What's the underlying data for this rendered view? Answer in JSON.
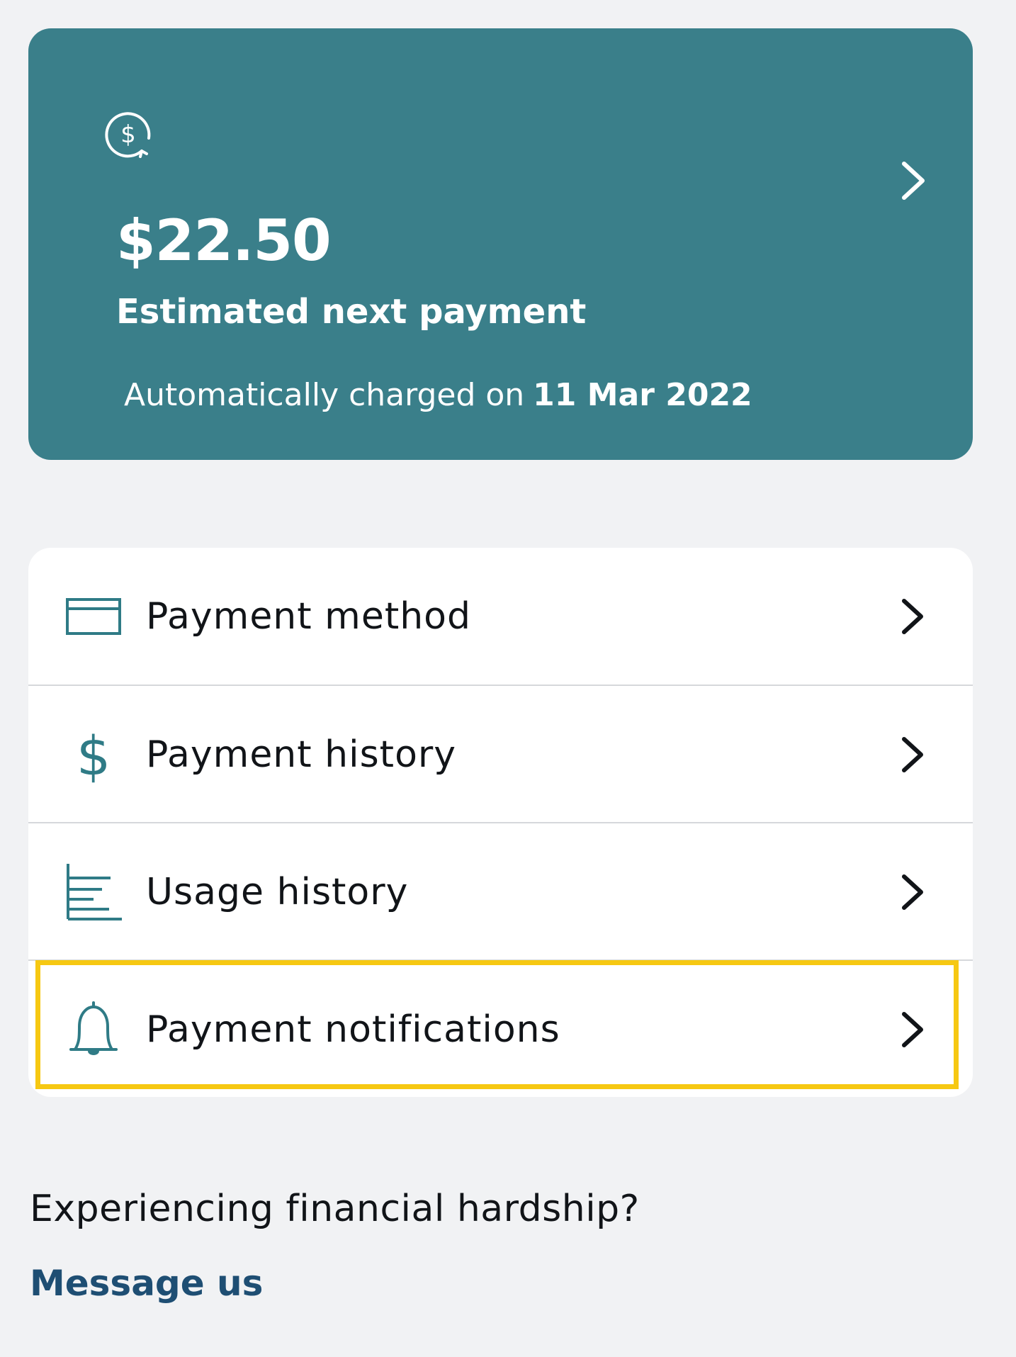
{
  "summary": {
    "amount": "$22.50",
    "amount_label": "Estimated next payment",
    "charge_prefix": "Automatically charged on",
    "charge_date": "11 Mar 2022",
    "icon": "dollar-cycle-icon",
    "background_color": "#3a7f8a"
  },
  "menu": {
    "items": [
      {
        "label": "Payment method",
        "icon": "card-icon"
      },
      {
        "label": "Payment history",
        "icon": "dollar-icon"
      },
      {
        "label": "Usage history",
        "icon": "bar-chart-icon"
      },
      {
        "label": "Payment notifications",
        "icon": "bell-icon",
        "highlighted": true
      }
    ],
    "icon_color": "#2f7b86",
    "highlight_color": "#f6c812"
  },
  "footer": {
    "question": "Experiencing financial hardship?",
    "link_label": "Message us",
    "link_color": "#1e4e73"
  }
}
